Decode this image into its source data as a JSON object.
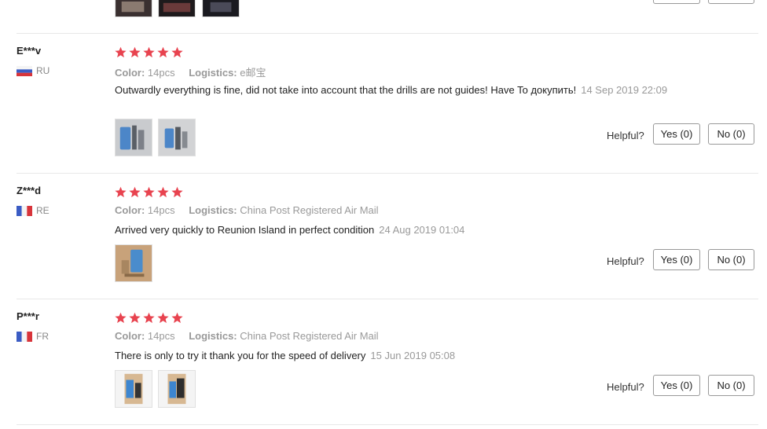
{
  "reviews": [
    {
      "user": "E***v",
      "country": "RU",
      "color_label": "Color:",
      "color_value": "14pcs",
      "logistics_label": "Logistics:",
      "logistics_value": "e邮宝",
      "text": "Outwardly everything is fine, did not take into account that the drills are not guides! Have To докупить!",
      "date": "14 Sep 2019 22:09",
      "rating": 5,
      "helpful_label": "Helpful?",
      "yes_label": "Yes (0)",
      "no_label": "No (0)"
    },
    {
      "user": "Z***d",
      "country": "RE",
      "color_label": "Color:",
      "color_value": "14pcs",
      "logistics_label": "Logistics:",
      "logistics_value": "China Post Registered Air Mail",
      "text": "Arrived very quickly to Reunion Island in perfect condition",
      "date": "24 Aug 2019 01:04",
      "rating": 5,
      "helpful_label": "Helpful?",
      "yes_label": "Yes (0)",
      "no_label": "No (0)"
    },
    {
      "user": "P***r",
      "country": "FR",
      "color_label": "Color:",
      "color_value": "14pcs",
      "logistics_label": "Logistics:",
      "logistics_value": "China Post Registered Air Mail",
      "text": "There is only to try it thank you for the speed of delivery",
      "date": "15 Jun 2019 05:08",
      "rating": 5,
      "helpful_label": "Helpful?",
      "yes_label": "Yes (0)",
      "no_label": "No (0)"
    }
  ],
  "colors": {
    "star": "#e8434f",
    "divider": "#e8e8e8",
    "muted": "#999999"
  }
}
